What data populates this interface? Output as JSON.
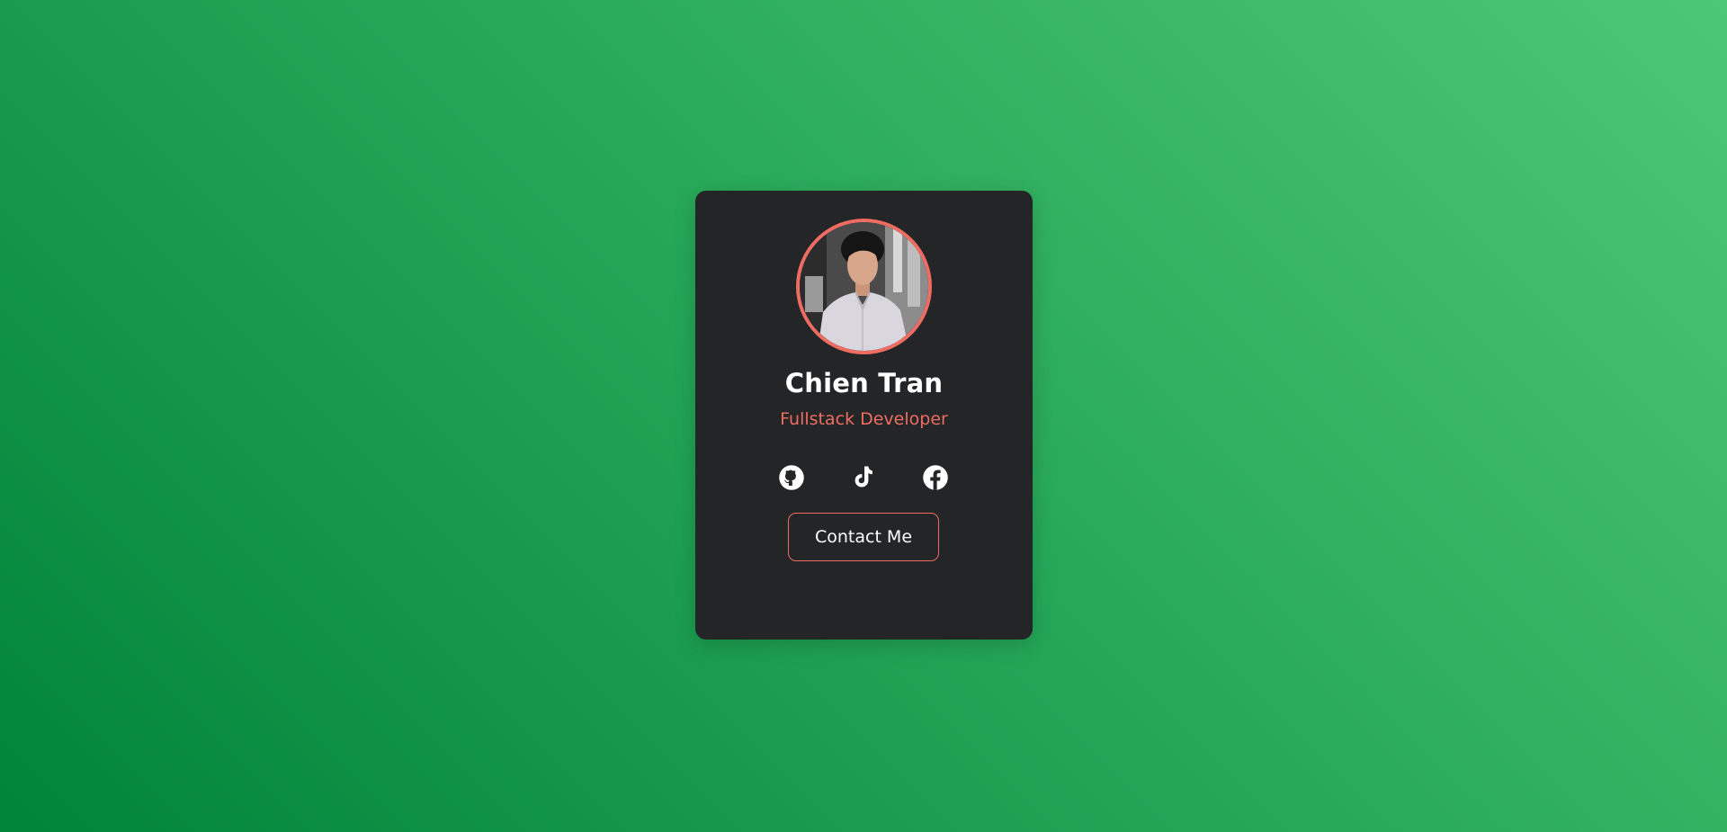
{
  "profile": {
    "name": "Chien Tran",
    "role": "Fullstack Developer",
    "avatar_icon": "profile-photo"
  },
  "socials": [
    {
      "icon": "github-icon"
    },
    {
      "icon": "tiktok-icon"
    },
    {
      "icon": "facebook-icon"
    }
  ],
  "actions": {
    "contact_label": "Contact Me"
  },
  "colors": {
    "card_background": "#242527",
    "accent": "#ee6c62",
    "text": "#ffffff",
    "background_gradient_start": "#00843a",
    "background_gradient_end": "#4cc776"
  }
}
